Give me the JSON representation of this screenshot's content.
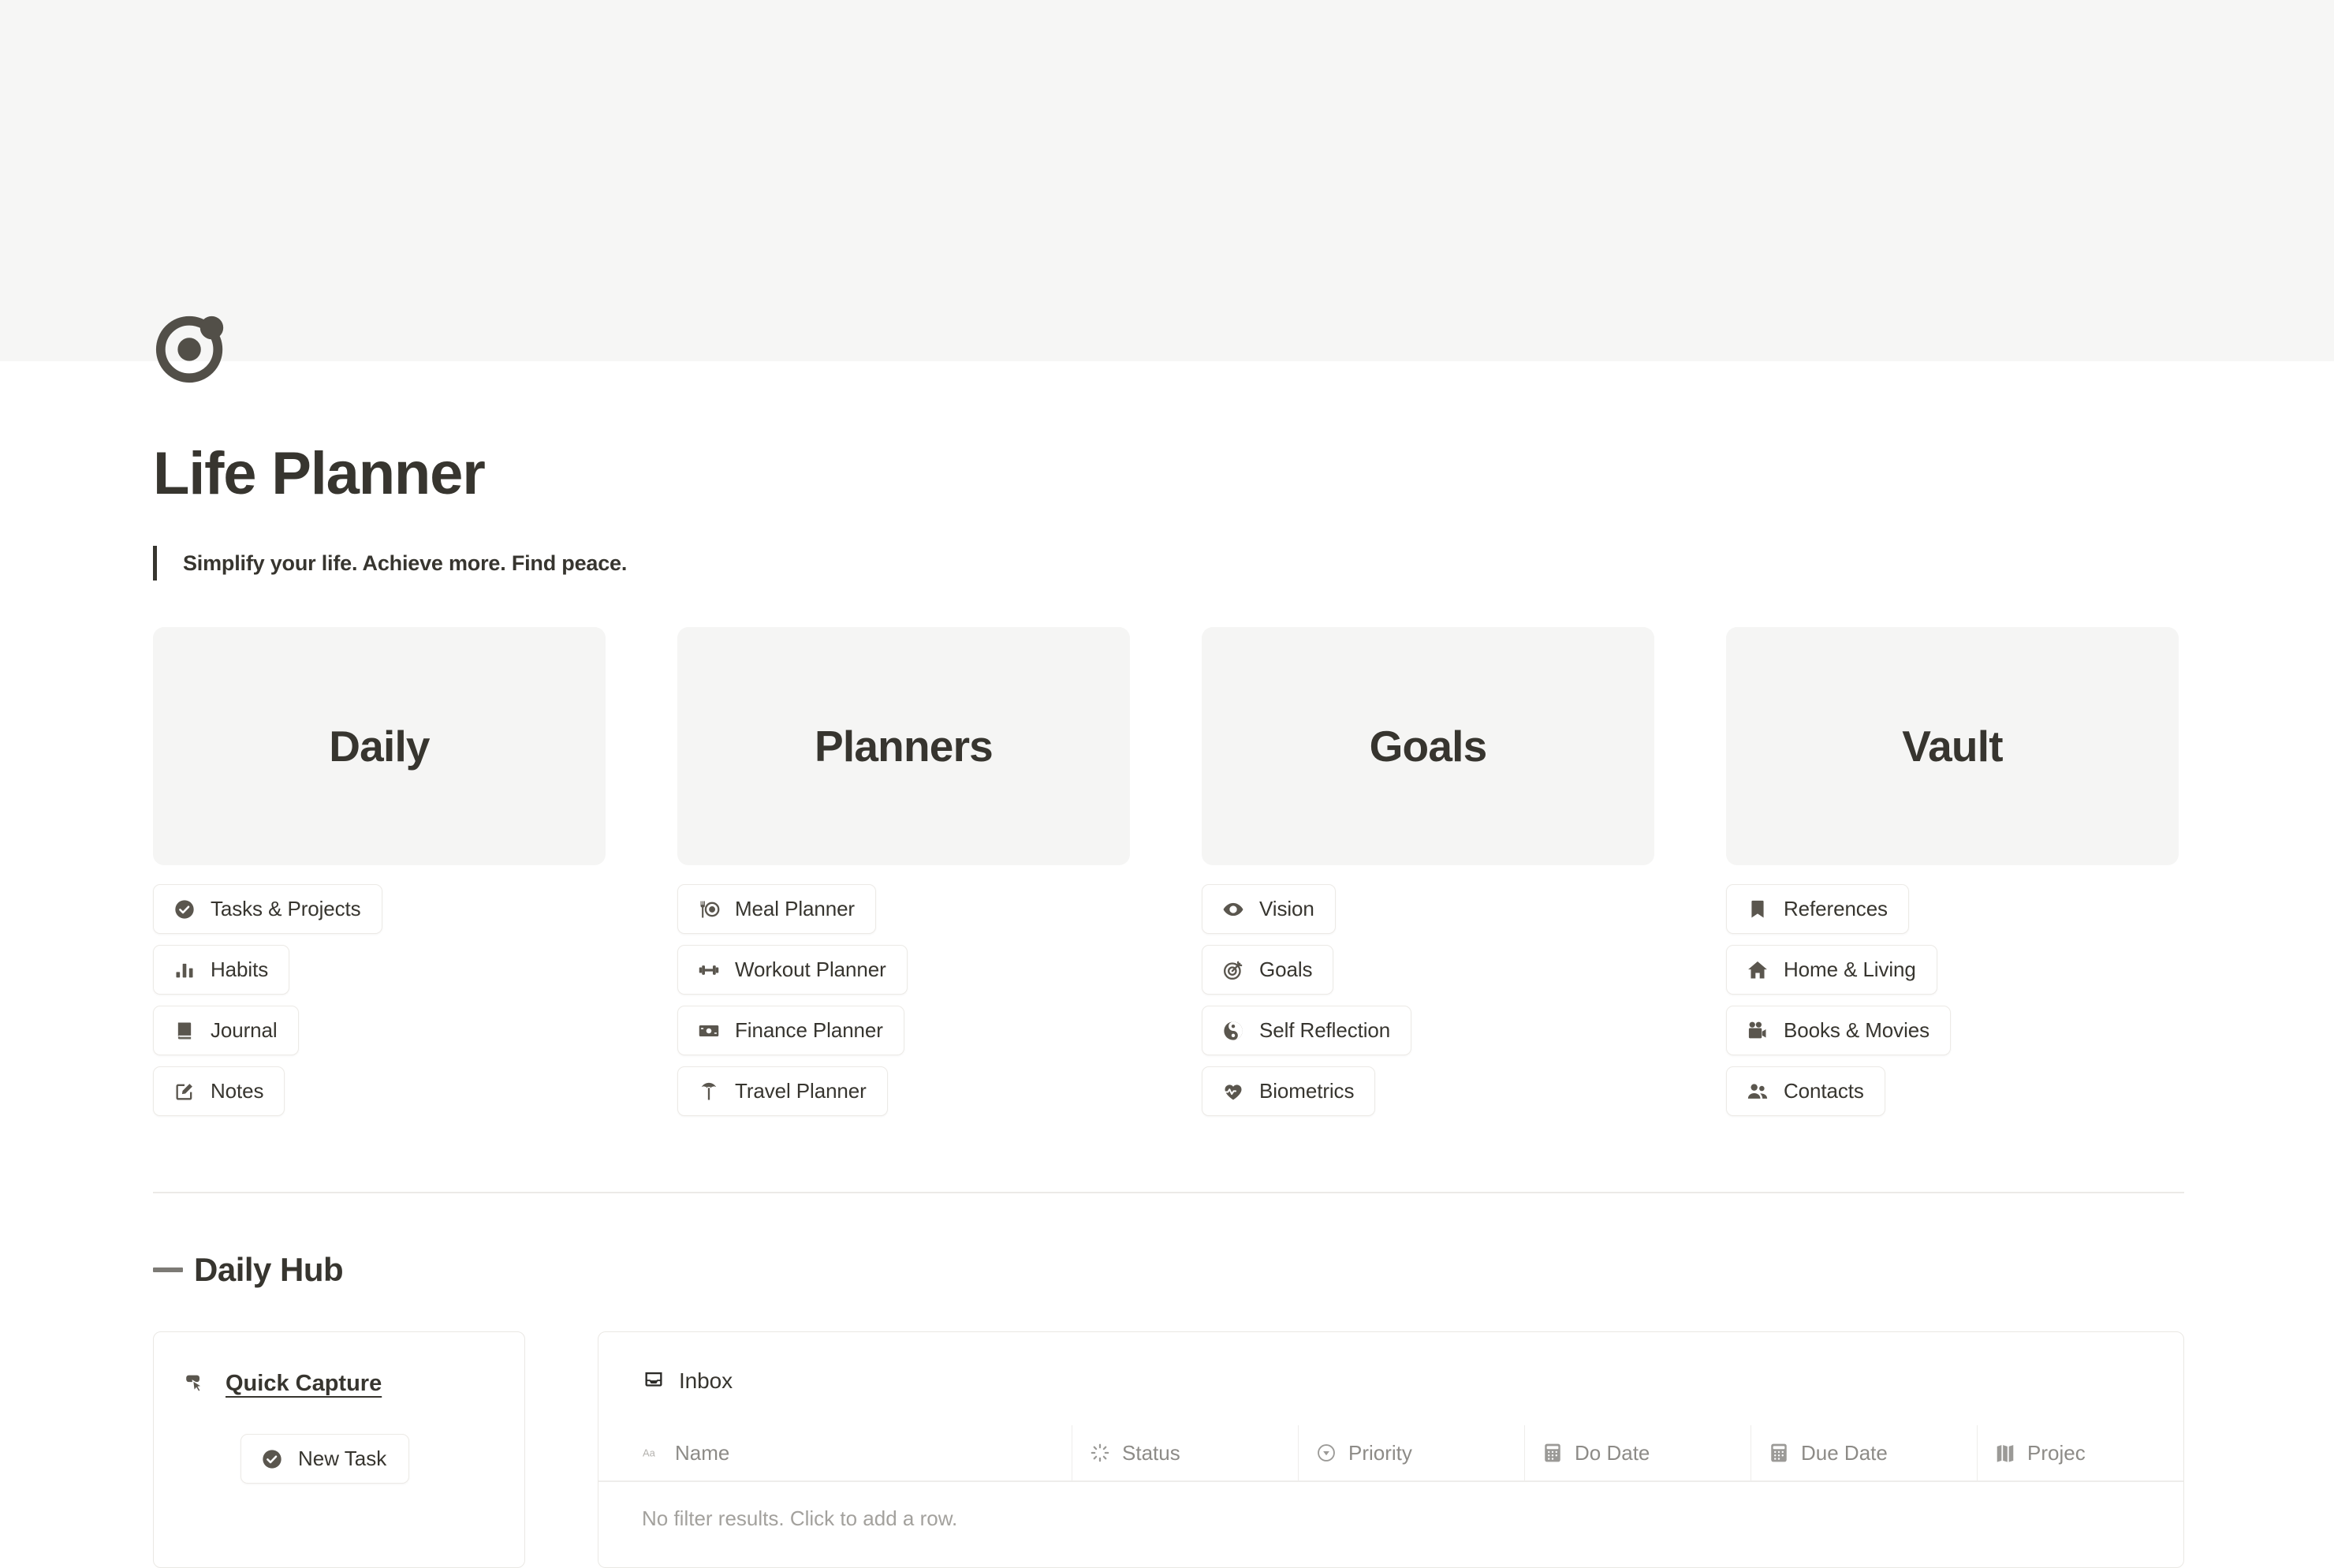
{
  "page": {
    "title": "Life Planner",
    "tagline": "Simplify your life. Achieve more. Find peace.",
    "logo_icon": "atom-circle-logo"
  },
  "colors": {
    "cover_bg": "#f6f6f5",
    "card_bg": "#f5f5f4",
    "text": "#37352f",
    "muted_text": "#8d8b87",
    "border": "#eceae6",
    "icon": "#5a564e"
  },
  "columns": [
    {
      "title": "Daily",
      "links": [
        {
          "label": "Tasks & Projects",
          "icon": "check-circle-icon"
        },
        {
          "label": "Habits",
          "icon": "bar-chart-icon"
        },
        {
          "label": "Journal",
          "icon": "book-icon"
        },
        {
          "label": "Notes",
          "icon": "edit-note-icon"
        }
      ]
    },
    {
      "title": "Planners",
      "links": [
        {
          "label": "Meal Planner",
          "icon": "fork-plate-icon"
        },
        {
          "label": "Workout Planner",
          "icon": "dumbbell-icon"
        },
        {
          "label": "Finance Planner",
          "icon": "banknote-icon"
        },
        {
          "label": "Travel Planner",
          "icon": "palm-tree-icon"
        }
      ]
    },
    {
      "title": "Goals",
      "links": [
        {
          "label": "Vision",
          "icon": "eye-icon"
        },
        {
          "label": "Goals",
          "icon": "target-arrow-icon"
        },
        {
          "label": "Self Reflection",
          "icon": "yin-yang-icon"
        },
        {
          "label": "Biometrics",
          "icon": "heart-pulse-icon"
        }
      ]
    },
    {
      "title": "Vault",
      "links": [
        {
          "label": "References",
          "icon": "bookmark-icon"
        },
        {
          "label": "Home & Living",
          "icon": "house-icon"
        },
        {
          "label": "Books & Movies",
          "icon": "movie-camera-icon"
        },
        {
          "label": "Contacts",
          "icon": "people-icon"
        }
      ]
    }
  ],
  "daily_hub": {
    "heading": "Daily Hub",
    "quick_capture": {
      "title": "Quick Capture",
      "icon": "cursor-click-icon",
      "new_task_label": "New Task",
      "new_task_icon": "check-circle-icon"
    },
    "inbox": {
      "title": "Inbox",
      "icon": "inbox-tray-icon",
      "columns": [
        {
          "label": "Name",
          "icon": "text-aa-icon"
        },
        {
          "label": "Status",
          "icon": "loading-spinner-icon"
        },
        {
          "label": "Priority",
          "icon": "select-chevron-icon"
        },
        {
          "label": "Do Date",
          "icon": "calendar-icon"
        },
        {
          "label": "Due Date",
          "icon": "calendar-icon"
        },
        {
          "label": "Projec",
          "icon": "relation-icon"
        }
      ],
      "empty_message": "No filter results. Click to add a row."
    }
  }
}
